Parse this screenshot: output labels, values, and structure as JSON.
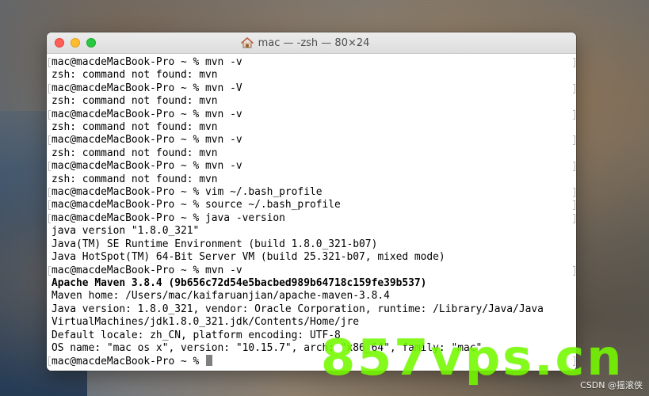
{
  "window": {
    "title": "mac — -zsh — 80×24",
    "icon": "home-icon"
  },
  "terminal": {
    "lines": [
      {
        "text": "mac@macdeMacBook-Pro ~ % mvn -v",
        "bold": false,
        "marked": true
      },
      {
        "text": "zsh: command not found: mvn",
        "bold": false,
        "marked": false
      },
      {
        "text": "mac@macdeMacBook-Pro ~ % mvn -V",
        "bold": false,
        "marked": true
      },
      {
        "text": "zsh: command not found: mvn",
        "bold": false,
        "marked": false
      },
      {
        "text": "mac@macdeMacBook-Pro ~ % mvn -v",
        "bold": false,
        "marked": true
      },
      {
        "text": "zsh: command not found: mvn",
        "bold": false,
        "marked": false
      },
      {
        "text": "mac@macdeMacBook-Pro ~ % mvn -v",
        "bold": false,
        "marked": true
      },
      {
        "text": "zsh: command not found: mvn",
        "bold": false,
        "marked": false
      },
      {
        "text": "mac@macdeMacBook-Pro ~ % mvn -v",
        "bold": false,
        "marked": true
      },
      {
        "text": "zsh: command not found: mvn",
        "bold": false,
        "marked": false
      },
      {
        "text": "mac@macdeMacBook-Pro ~ % vim ~/.bash_profile",
        "bold": false,
        "marked": true
      },
      {
        "text": "mac@macdeMacBook-Pro ~ % source ~/.bash_profile",
        "bold": false,
        "marked": true
      },
      {
        "text": "mac@macdeMacBook-Pro ~ % java -version",
        "bold": false,
        "marked": true
      },
      {
        "text": "java version \"1.8.0_321\"",
        "bold": false,
        "marked": false
      },
      {
        "text": "Java(TM) SE Runtime Environment (build 1.8.0_321-b07)",
        "bold": false,
        "marked": false
      },
      {
        "text": "Java HotSpot(TM) 64-Bit Server VM (build 25.321-b07, mixed mode)",
        "bold": false,
        "marked": false
      },
      {
        "text": "mac@macdeMacBook-Pro ~ % mvn -v",
        "bold": false,
        "marked": true
      },
      {
        "text": "Apache Maven 3.8.4 (9b656c72d54e5bacbed989b64718c159fe39b537)",
        "bold": true,
        "marked": false
      },
      {
        "text": "Maven home: /Users/mac/kaifaruanjian/apache-maven-3.8.4",
        "bold": false,
        "marked": false
      },
      {
        "text": "Java version: 1.8.0_321, vendor: Oracle Corporation, runtime: /Library/Java/Java",
        "bold": false,
        "marked": false
      },
      {
        "text": "VirtualMachines/jdk1.8.0_321.jdk/Contents/Home/jre",
        "bold": false,
        "marked": false
      },
      {
        "text": "Default locale: zh_CN, platform encoding: UTF-8",
        "bold": false,
        "marked": false
      },
      {
        "text": "OS name: \"mac os x\", version: \"10.15.7\", arch: \"x86_64\", family: \"mac\"",
        "bold": false,
        "marked": false
      },
      {
        "text": "mac@macdeMacBook-Pro ~ % ",
        "bold": false,
        "marked": true,
        "cursor": true
      }
    ]
  },
  "overlay": {
    "watermark": "857vps.cn",
    "credit": "CSDN @摇滚侠"
  }
}
